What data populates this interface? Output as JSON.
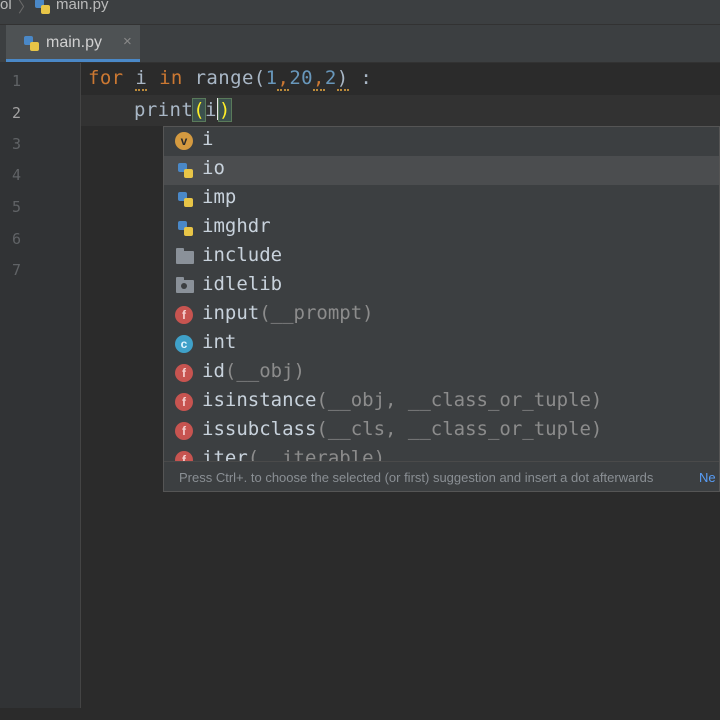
{
  "breadcrumb": {
    "project_fragment": "ol",
    "file": "main.py"
  },
  "tabs": [
    {
      "label": "main.py",
      "close": "×"
    }
  ],
  "gutter": {
    "line_numbers": [
      "1",
      "2",
      "3",
      "4",
      "5",
      "6",
      "7"
    ]
  },
  "code": {
    "line1": {
      "kw_for": "for",
      "var": "i",
      "kw_in": "in",
      "func": "range",
      "open": "(",
      "n1": "1",
      "c1": ",",
      "n2": "20",
      "c2": ",",
      "n3": "2",
      "close": ")",
      "colon": ":"
    },
    "line2": {
      "func": "print",
      "open": "(",
      "arg": "i",
      "close": ")"
    }
  },
  "completion": {
    "items": [
      {
        "icon": "variable-icon",
        "badge": "v",
        "name": "i",
        "args": ""
      },
      {
        "icon": "python-module-icon",
        "badge": "",
        "name": "io",
        "args": ""
      },
      {
        "icon": "python-module-icon",
        "badge": "",
        "name": "imp",
        "args": ""
      },
      {
        "icon": "python-module-icon",
        "badge": "",
        "name": "imghdr",
        "args": ""
      },
      {
        "icon": "folder-icon",
        "badge": "",
        "name": "include",
        "args": ""
      },
      {
        "icon": "package-folder-icon",
        "badge": "",
        "name": "idlelib",
        "args": ""
      },
      {
        "icon": "function-icon",
        "badge": "f",
        "name": "input",
        "args": "(__prompt)"
      },
      {
        "icon": "class-icon",
        "badge": "c",
        "name": "int",
        "args": ""
      },
      {
        "icon": "function-icon",
        "badge": "f",
        "name": "id",
        "args": "(__obj)"
      },
      {
        "icon": "function-icon",
        "badge": "f",
        "name": "isinstance",
        "args": "(__obj, __class_or_tuple)"
      },
      {
        "icon": "function-icon",
        "badge": "f",
        "name": "issubclass",
        "args": "(__cls, __class_or_tuple)"
      },
      {
        "icon": "function-icon",
        "badge": "f",
        "name": "iter",
        "args": "(__iterable)"
      }
    ],
    "selected_index": 1,
    "hint": "Press Ctrl+. to choose the selected (or first) suggestion and insert a dot afterwards",
    "hint_link": "Ne"
  },
  "colors": {
    "background": "#2b2b2b",
    "keyword": "#cc7832",
    "number": "#6897bb",
    "accent": "#4a88c7"
  }
}
